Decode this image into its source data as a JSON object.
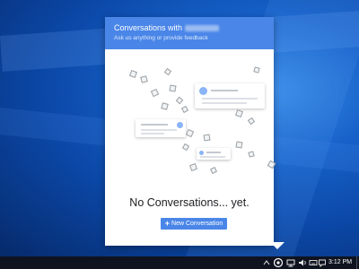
{
  "widget": {
    "title_prefix": "Conversations with",
    "subtitle": "Ask us anything or provide feedback",
    "empty_message": "No Conversations... yet.",
    "new_button_label": "New Conversation",
    "accent_color": "#4a86e8"
  },
  "taskbar": {
    "clock": "3:12 PM",
    "tray_icons": [
      "chevron-up-icon",
      "widget-app-icon",
      "network-icon",
      "volume-icon",
      "keyboard-icon",
      "action-center-icon"
    ]
  }
}
